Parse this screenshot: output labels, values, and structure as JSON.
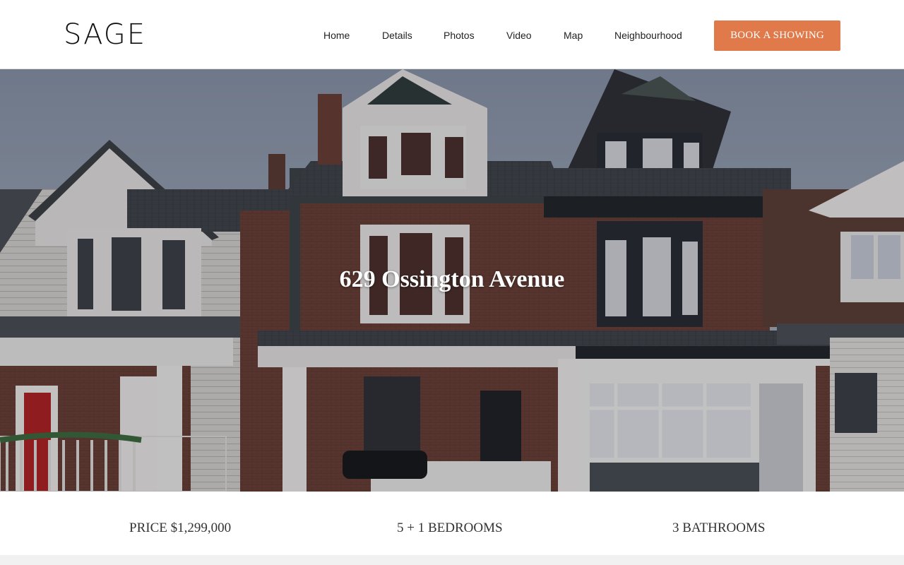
{
  "brand": {
    "logo": "SAGE"
  },
  "nav": {
    "items": [
      {
        "label": "Home"
      },
      {
        "label": "Details"
      },
      {
        "label": "Photos"
      },
      {
        "label": "Video"
      },
      {
        "label": "Map"
      },
      {
        "label": "Neighbourhood"
      }
    ],
    "cta_label": "BOOK A SHOWING"
  },
  "hero": {
    "title": "629 Ossington Avenue",
    "image": "house-facade-photo"
  },
  "stats": {
    "price": "PRICE $1,299,000",
    "bedrooms": "5 + 1 BEDROOMS",
    "bathrooms": "3 BATHROOMS"
  },
  "colors": {
    "accent": "#e07a4a",
    "header_bg": "#ffffff",
    "text": "#222222"
  }
}
